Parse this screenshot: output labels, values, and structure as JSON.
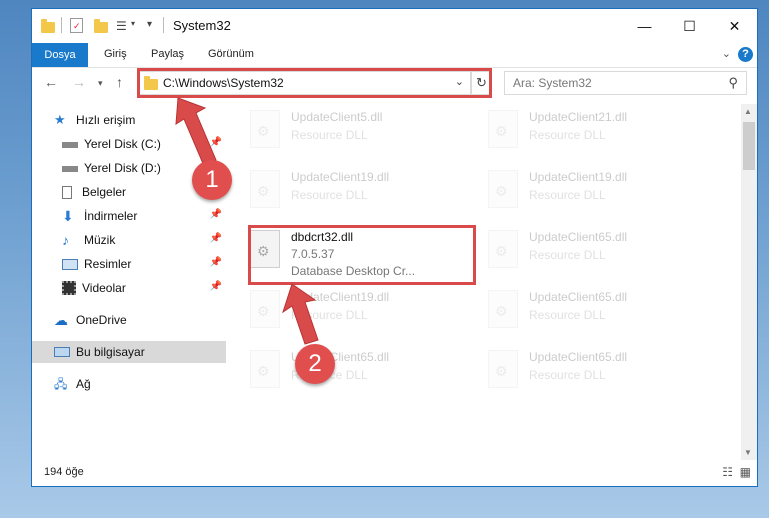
{
  "window": {
    "title": "System32"
  },
  "ribbon": {
    "tabs": [
      "Dosya",
      "Giriş",
      "Paylaş",
      "Görünüm"
    ],
    "help": "?"
  },
  "address": {
    "path": "C:\\Windows\\System32"
  },
  "search": {
    "placeholder": "Ara: System32"
  },
  "sidebar": {
    "items": [
      {
        "label": "Hızlı erişim"
      },
      {
        "label": "Yerel Disk (C:)"
      },
      {
        "label": "Yerel Disk (D:)"
      },
      {
        "label": "Belgeler"
      },
      {
        "label": "İndirmeler"
      },
      {
        "label": "Müzik"
      },
      {
        "label": "Resimler"
      },
      {
        "label": "Videolar"
      },
      {
        "label": "OneDrive"
      },
      {
        "label": "Bu bilgisayar"
      },
      {
        "label": "Ağ"
      }
    ]
  },
  "files": {
    "left": [
      {
        "name": "UpdateClient5.dll",
        "type": "Resource DLL"
      },
      {
        "name": "UpdateClient19.dll",
        "type": "Resource DLL"
      },
      {
        "name": "dbdcrt32.dll",
        "version": "7.0.5.37",
        "desc": "Database Desktop Cr..."
      },
      {
        "name": "UpdateClient19.dll",
        "type": "Resource DLL"
      },
      {
        "name": "UpdateClient65.dll",
        "type": "Resource DLL"
      }
    ],
    "right": [
      {
        "name": "UpdateClient21.dll",
        "type": "Resource DLL"
      },
      {
        "name": "UpdateClient19.dll",
        "type": "Resource DLL"
      },
      {
        "name": "UpdateClient65.dll",
        "type": "Resource DLL"
      },
      {
        "name": "UpdateClient65.dll",
        "type": "Resource DLL"
      },
      {
        "name": "UpdateClient65.dll",
        "type": "Resource DLL"
      }
    ]
  },
  "status": {
    "count": "194 öğe"
  },
  "annotations": {
    "step1": "1",
    "step2": "2",
    "color": "#d94b4b"
  }
}
